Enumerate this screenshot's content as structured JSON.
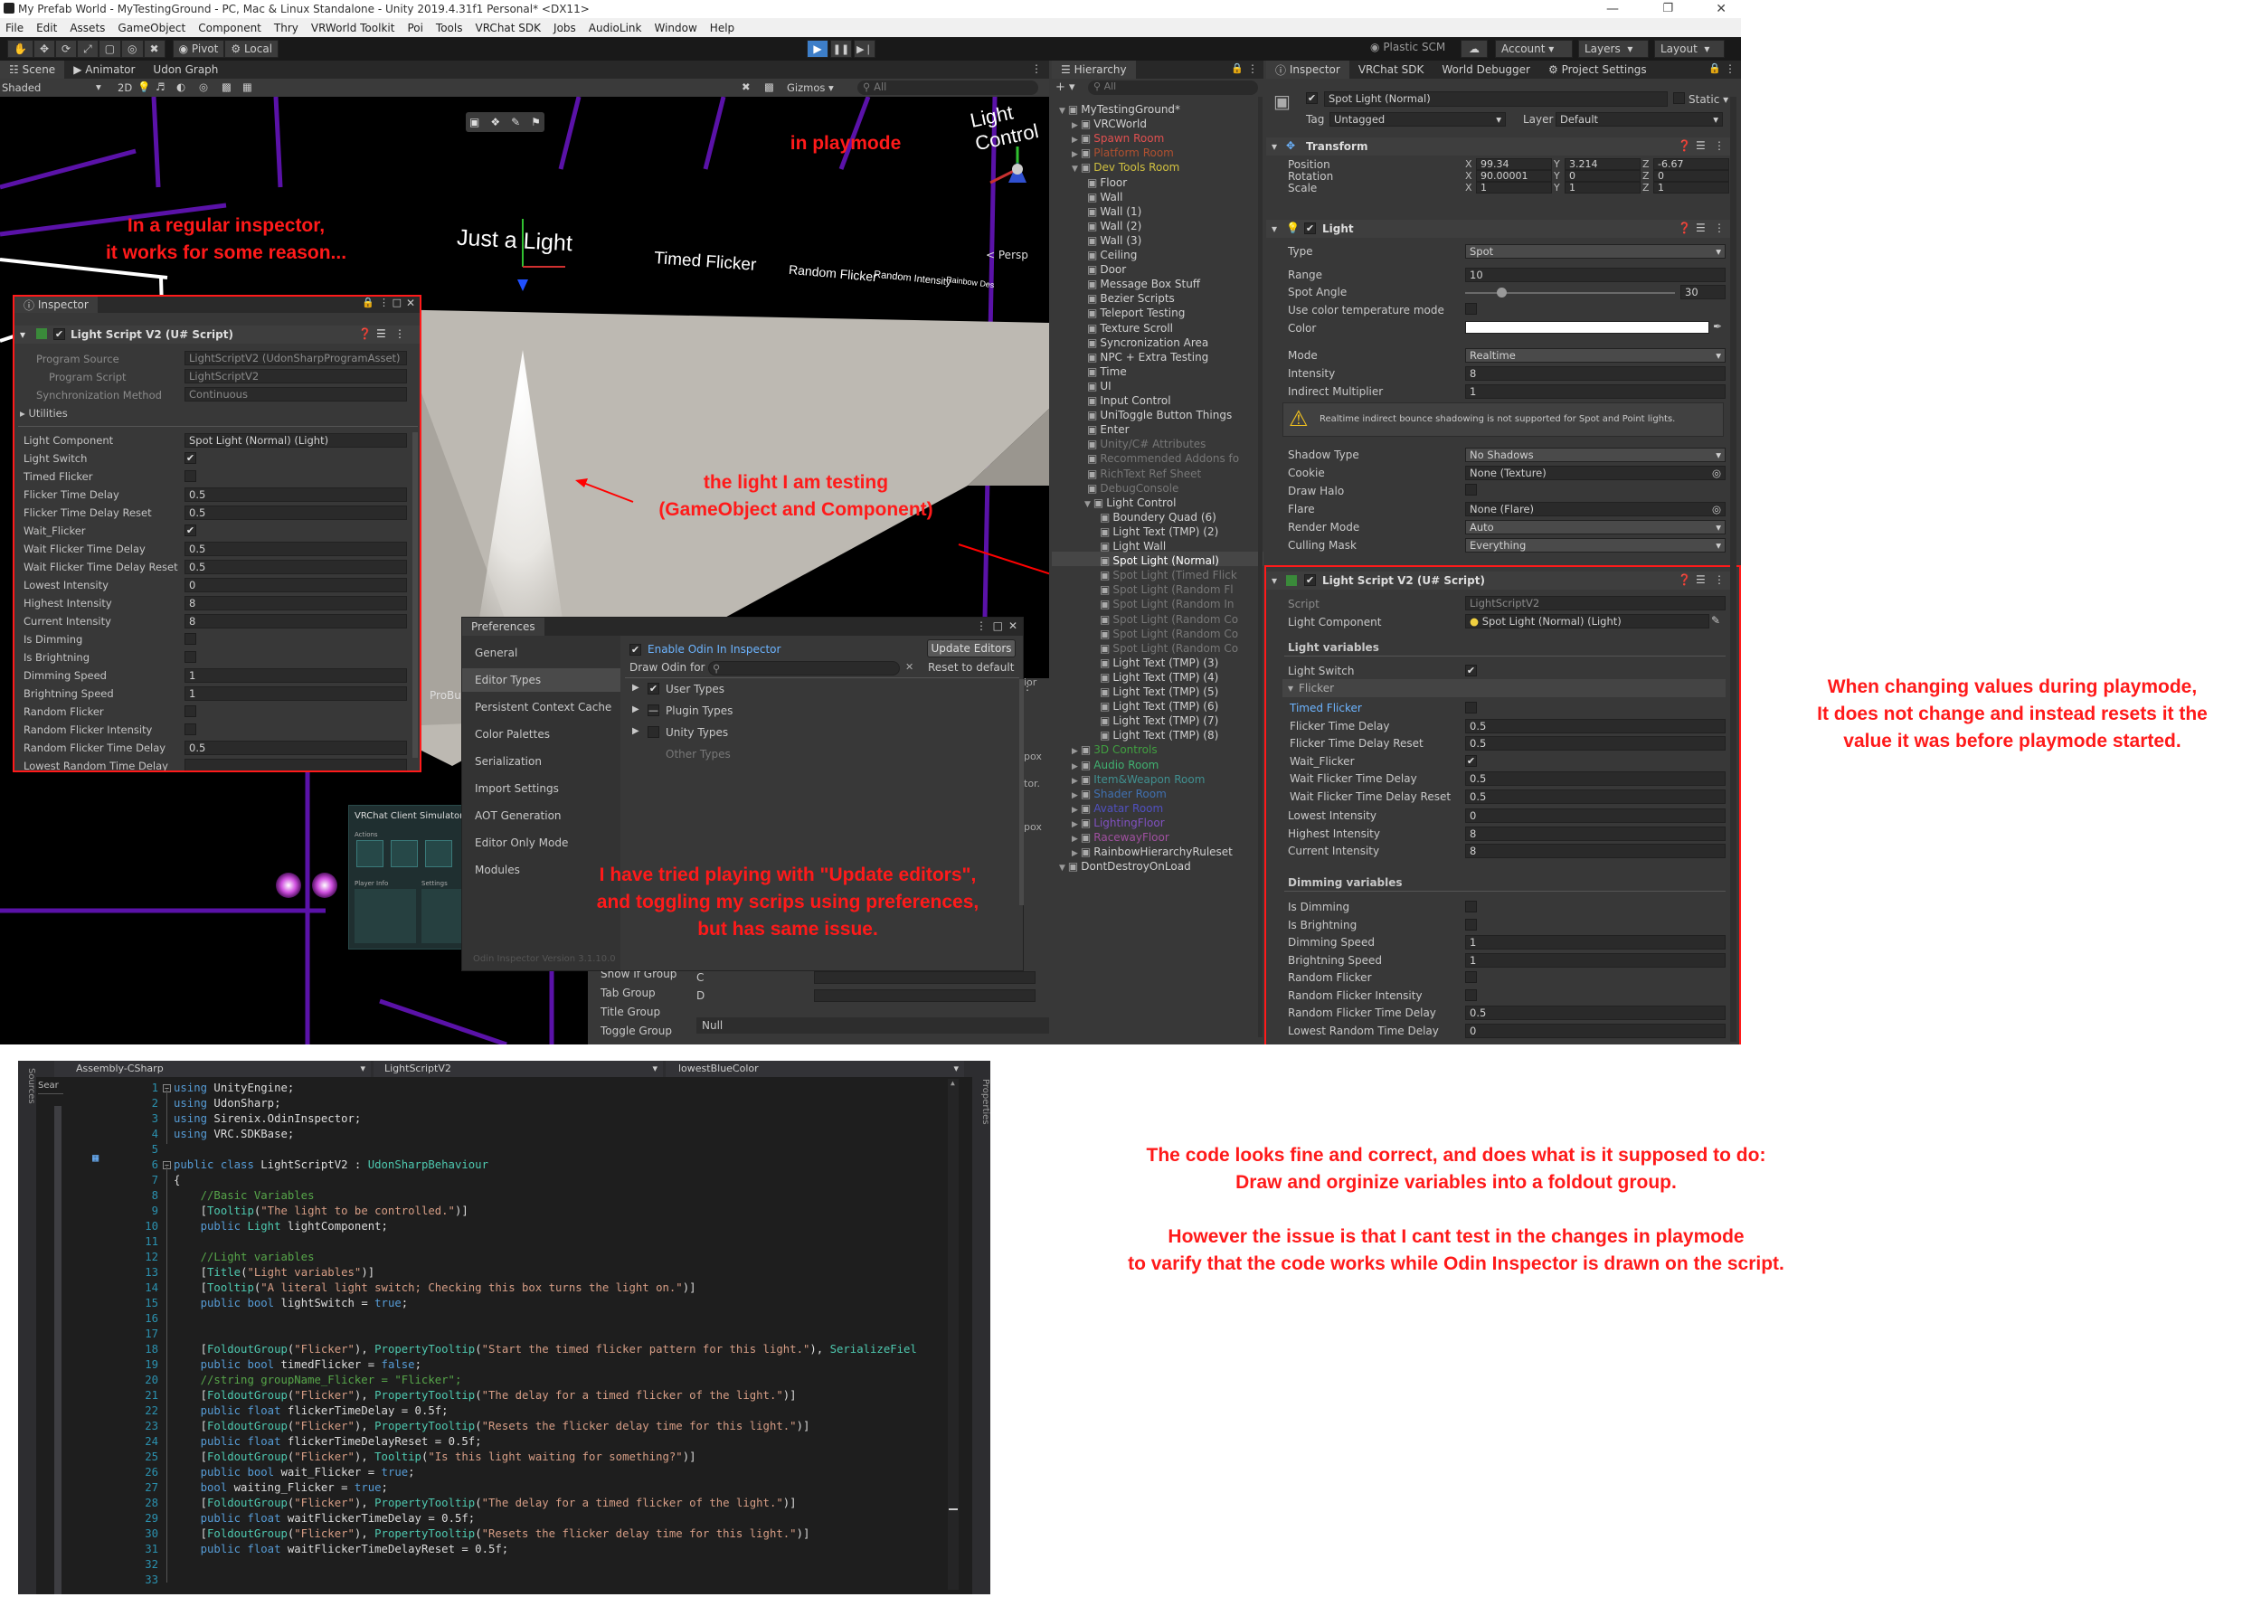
{
  "window": {
    "title": "My Prefab World - MyTestingGround - PC, Mac & Linux Standalone - Unity 2019.4.31f1 Personal* <DX11>"
  },
  "menu": [
    "File",
    "Edit",
    "Assets",
    "GameObject",
    "Component",
    "Thry",
    "VRWorld Toolkit",
    "Poi",
    "Tools",
    "VRChat SDK",
    "Jobs",
    "AudioLink",
    "Window",
    "Help"
  ],
  "toolbar": {
    "pivot": "Pivot",
    "local": "Local",
    "plastic": "Plastic SCM",
    "account": "Account",
    "layers": "Layers",
    "layout": "Layout"
  },
  "scene": {
    "tabs": [
      "Scene",
      "Animator",
      "Udon Graph"
    ],
    "shading": "Shaded",
    "mode2d": "2D",
    "gizmos": "Gizmos",
    "search_placeholder": "All",
    "persp": "Persp",
    "labels": {
      "just_a_light": "Just a Light",
      "timed_flicker": "Timed Flicker",
      "random_flicker": "Random Flicker",
      "random_intensity": "Random Intensity",
      "rainbow": "Rainbow Des",
      "light_control": "Light Control",
      "probu": "ProBu"
    }
  },
  "annotations": {
    "playmode": "in playmode",
    "regular": "In a regular inspector,\nit works for some reason...",
    "light_testing": "the light I am testing\n(GameObject and Component)",
    "tried": "I have tried playing with \"Update editors\",\nand toggling my scrips using preferences,\nbut has same issue.",
    "changing": "When changing values during playmode,\nIt does not change and instead resets it the\nvalue it was before playmode started.",
    "code_fine": "The code looks fine and correct, and does what is it supposed to do:\nDraw and orginize variables into a foldout group.",
    "cant_test": "However the issue is that I cant test in the changes in playmode\nto varify that the code works while Odin Inspector is drawn on the script."
  },
  "float_inspector": {
    "tab": "Inspector",
    "component": "Light Script V2 (U# Script)",
    "program_source_label": "Program Source",
    "program_source_value": "LightScriptV2 (UdonSharpProgramAsset)",
    "program_script_label": "Program Script",
    "program_script_value": "LightScriptV2",
    "sync_label": "Synchronization Method",
    "sync_value": "Continuous",
    "utilities": "Utilities",
    "rows": [
      {
        "label": "Light Component",
        "value": "Spot Light (Normal) (Light)"
      },
      {
        "label": "Light Switch",
        "value": "✔"
      },
      {
        "label": "Timed Flicker",
        "value": ""
      },
      {
        "label": "Flicker Time Delay",
        "value": "0.5"
      },
      {
        "label": "Flicker Time Delay Reset",
        "value": "0.5"
      },
      {
        "label": "Wait_Flicker",
        "value": "✔"
      },
      {
        "label": "Wait Flicker Time Delay",
        "value": "0.5"
      },
      {
        "label": "Wait Flicker Time Delay Reset",
        "value": "0.5"
      },
      {
        "label": "Lowest Intensity",
        "value": "0"
      },
      {
        "label": "Highest Intensity",
        "value": "8"
      },
      {
        "label": "Current Intensity",
        "value": "8"
      },
      {
        "label": "Is Dimming",
        "value": ""
      },
      {
        "label": "Is Brightning",
        "value": ""
      },
      {
        "label": "Dimming Speed",
        "value": "1"
      },
      {
        "label": "Brightning Speed",
        "value": "1"
      },
      {
        "label": "Random Flicker",
        "value": ""
      },
      {
        "label": "Random Flicker Intensity",
        "value": ""
      },
      {
        "label": "Random Flicker Time Delay",
        "value": "0.5"
      },
      {
        "label": "Lowest Random Time Delay",
        "value": ""
      }
    ]
  },
  "preferences": {
    "title": "Preferences",
    "sidebar": [
      "General",
      "Editor Types",
      "Persistent Context Cache",
      "Color Palettes",
      "Serialization",
      "Import Settings",
      "AOT Generation",
      "Editor Only Mode",
      "Modules"
    ],
    "enable_odin": "Enable Odin In Inspector",
    "update_editors": "Update Editors",
    "draw_odin_for": "Draw Odin for",
    "reset_default": "Reset to default",
    "types": [
      "User Types",
      "Plugin Types",
      "Unity Types",
      "Other Types"
    ],
    "version": "Odin Inspector Version 3.1.10.0"
  },
  "behind_panel": {
    "items": [
      "Show If Group",
      "Tab Group",
      "Title Group",
      "Toggle Group"
    ],
    "c": "C",
    "d": "D",
    "null": "Null"
  },
  "simulator": {
    "title": "VRChat Client Simulator",
    "actions": "Actions",
    "player_info": "Player Info",
    "settings": "Settings"
  },
  "hierarchy": {
    "tab": "Hierarchy",
    "search": "All",
    "items": [
      {
        "t": "MyTestingGround*",
        "d": 0,
        "c": "#d0d0d0"
      },
      {
        "t": "VRCWorld",
        "d": 1,
        "c": "#d0d0d0"
      },
      {
        "t": "Spawn Room",
        "d": 1,
        "c": "#e05050"
      },
      {
        "t": "Platform Room",
        "d": 1,
        "c": "#b05030"
      },
      {
        "t": "Dev Tools Room",
        "d": 1,
        "c": "#d0c040"
      },
      {
        "t": "Floor",
        "d": 2,
        "c": "#d0d0d0"
      },
      {
        "t": "Wall",
        "d": 2,
        "c": "#d0d0d0"
      },
      {
        "t": "Wall (1)",
        "d": 2,
        "c": "#d0d0d0"
      },
      {
        "t": "Wall (2)",
        "d": 2,
        "c": "#d0d0d0"
      },
      {
        "t": "Wall (3)",
        "d": 2,
        "c": "#d0d0d0"
      },
      {
        "t": "Ceiling",
        "d": 2,
        "c": "#d0d0d0"
      },
      {
        "t": "Door",
        "d": 2,
        "c": "#d0d0d0"
      },
      {
        "t": "Message Box Stuff",
        "d": 2,
        "c": "#d0d0d0"
      },
      {
        "t": "Bezier Scripts",
        "d": 2,
        "c": "#d0d0d0"
      },
      {
        "t": "Teleport Testing",
        "d": 2,
        "c": "#d0d0d0"
      },
      {
        "t": "Texture Scroll",
        "d": 2,
        "c": "#d0d0d0"
      },
      {
        "t": "Syncronization Area",
        "d": 2,
        "c": "#d0d0d0"
      },
      {
        "t": "NPC + Extra Testing",
        "d": 2,
        "c": "#d0d0d0"
      },
      {
        "t": "Time",
        "d": 2,
        "c": "#d0d0d0"
      },
      {
        "t": "UI",
        "d": 2,
        "c": "#d0d0d0"
      },
      {
        "t": "Input Control",
        "d": 2,
        "c": "#d0d0d0"
      },
      {
        "t": "UniToggle Button Things",
        "d": 2,
        "c": "#d0d0d0"
      },
      {
        "t": "Enter",
        "d": 2,
        "c": "#d0d0d0"
      },
      {
        "t": "Unity/C# Attributes",
        "d": 2,
        "c": "#777777"
      },
      {
        "t": "Recommended Addons fo",
        "d": 2,
        "c": "#777777"
      },
      {
        "t": "RichText Ref Sheet",
        "d": 2,
        "c": "#777777"
      },
      {
        "t": "DebugConsole",
        "d": 2,
        "c": "#777777"
      },
      {
        "t": "Light Control",
        "d": 2,
        "c": "#d0d0d0"
      },
      {
        "t": "Boundery Quad (6)",
        "d": 3,
        "c": "#d0d0d0"
      },
      {
        "t": "Light Text (TMP) (2)",
        "d": 3,
        "c": "#d0d0d0"
      },
      {
        "t": "Light Wall",
        "d": 3,
        "c": "#d0d0d0"
      },
      {
        "t": "Spot Light (Normal)",
        "d": 3,
        "c": "#ffffff"
      },
      {
        "t": "Spot Light (Timed Flick",
        "d": 3,
        "c": "#777777"
      },
      {
        "t": "Spot Light (Random Fl",
        "d": 3,
        "c": "#777777"
      },
      {
        "t": "Spot Light (Random In",
        "d": 3,
        "c": "#777777"
      },
      {
        "t": "Spot Light (Random Co",
        "d": 3,
        "c": "#777777"
      },
      {
        "t": "Spot Light (Random Co",
        "d": 3,
        "c": "#777777"
      },
      {
        "t": "Spot Light (Random Co",
        "d": 3,
        "c": "#777777"
      },
      {
        "t": "Light Text (TMP) (3)",
        "d": 3,
        "c": "#d0d0d0"
      },
      {
        "t": "Light Text (TMP) (4)",
        "d": 3,
        "c": "#d0d0d0"
      },
      {
        "t": "Light Text (TMP) (5)",
        "d": 3,
        "c": "#d0d0d0"
      },
      {
        "t": "Light Text (TMP) (6)",
        "d": 3,
        "c": "#d0d0d0"
      },
      {
        "t": "Light Text (TMP) (7)",
        "d": 3,
        "c": "#d0d0d0"
      },
      {
        "t": "Light Text (TMP) (8)",
        "d": 3,
        "c": "#d0d0d0"
      },
      {
        "t": "3D Controls",
        "d": 1,
        "c": "#40a040"
      },
      {
        "t": "Audio Room",
        "d": 1,
        "c": "#40b070"
      },
      {
        "t": "Item&Weapon Room",
        "d": 1,
        "c": "#409090"
      },
      {
        "t": "Shader Room",
        "d": 1,
        "c": "#4070b0"
      },
      {
        "t": "Avatar Room",
        "d": 1,
        "c": "#5050c0"
      },
      {
        "t": "LightingFloor",
        "d": 1,
        "c": "#8050c0"
      },
      {
        "t": "RacewayFloor",
        "d": 1,
        "c": "#a050a0"
      },
      {
        "t": "RainbowHierarchyRuleset",
        "d": 1,
        "c": "#d0d0d0"
      },
      {
        "t": "DontDestroyOnLoad",
        "d": 0,
        "c": "#d0d0d0"
      }
    ]
  },
  "inspector": {
    "tabs": [
      "Inspector",
      "VRChat SDK",
      "World Debugger",
      "Project Settings"
    ],
    "object_name": "Spot Light (Normal)",
    "static": "Static",
    "tag_label": "Tag",
    "tag_value": "Untagged",
    "layer_label": "Layer",
    "layer_value": "Default",
    "transform": {
      "title": "Transform",
      "position": {
        "label": "Position",
        "x": "99.34",
        "y": "3.214",
        "z": "-6.67"
      },
      "rotation": {
        "label": "Rotation",
        "x": "90.00001",
        "y": "0",
        "z": "0"
      },
      "scale": {
        "label": "Scale",
        "x": "1",
        "y": "1",
        "z": "1"
      }
    },
    "light": {
      "title": "Light",
      "type": {
        "label": "Type",
        "value": "Spot"
      },
      "range": {
        "label": "Range",
        "value": "10"
      },
      "spot_angle": {
        "label": "Spot Angle",
        "value": "30"
      },
      "use_temp": "Use color temperature mode",
      "color": "Color",
      "mode": {
        "label": "Mode",
        "value": "Realtime"
      },
      "intensity": {
        "label": "Intensity",
        "value": "8"
      },
      "indirect": {
        "label": "Indirect Multiplier",
        "value": "1"
      },
      "warning": "Realtime indirect bounce shadowing is not supported for Spot and Point lights.",
      "shadow": {
        "label": "Shadow Type",
        "value": "No Shadows"
      },
      "cookie": {
        "label": "Cookie",
        "value": "None (Texture)"
      },
      "halo": "Draw Halo",
      "flare": {
        "label": "Flare",
        "value": "None (Flare)"
      },
      "render_mode": {
        "label": "Render Mode",
        "value": "Auto"
      },
      "culling": {
        "label": "Culling Mask",
        "value": "Everything"
      }
    },
    "script": {
      "title": "Light Script V2 (U# Script)",
      "script_label": "Script",
      "script_value": "LightScriptV2",
      "light_comp_label": "Light Component",
      "light_comp_value": "Spot Light (Normal) (Light)",
      "light_vars": "Light variables",
      "light_switch": "Light Switch",
      "flicker": "Flicker",
      "flicker_rows": [
        {
          "label": "Timed Flicker",
          "value": ""
        },
        {
          "label": "Flicker Time Delay",
          "value": "0.5"
        },
        {
          "label": "Flicker Time Delay Reset",
          "value": "0.5"
        },
        {
          "label": "Wait_Flicker",
          "value": "✔"
        },
        {
          "label": "Wait Flicker Time Delay",
          "value": "0.5"
        },
        {
          "label": "Wait Flicker Time Delay Reset",
          "value": "0.5"
        }
      ],
      "intensity_rows": [
        {
          "label": "Lowest Intensity",
          "value": "0"
        },
        {
          "label": "Highest Intensity",
          "value": "8"
        },
        {
          "label": "Current Intensity",
          "value": "8"
        }
      ],
      "dimming_vars": "Dimming variables",
      "dimming_rows": [
        {
          "label": "Is Dimming",
          "value": ""
        },
        {
          "label": "Is Brightning",
          "value": ""
        },
        {
          "label": "Dimming Speed",
          "value": "1"
        },
        {
          "label": "Brightning Speed",
          "value": "1"
        },
        {
          "label": "Random Flicker",
          "value": ""
        },
        {
          "label": "Random Flicker Intensity",
          "value": ""
        },
        {
          "label": "Random Flicker Time Delay",
          "value": "0.5"
        },
        {
          "label": "Lowest Random Time Delay",
          "value": "0"
        }
      ]
    }
  },
  "code": {
    "project": "Assembly-CSharp",
    "class_dd": "LightScriptV2",
    "member_dd": "lowestBlueColor",
    "side_left": "Sources",
    "side_search": "Sear",
    "side_right": "Properties",
    "lines": [
      "using UnityEngine;",
      "using UdonSharp;",
      "using Sirenix.OdinInspector;",
      "using VRC.SDKBase;",
      "",
      "public class LightScriptV2 : UdonSharpBehaviour",
      "{",
      "    //Basic Variables",
      "    [Tooltip(\"The light to be controlled.\")]",
      "    public Light lightComponent;",
      "",
      "    //Light variables",
      "    [Title(\"Light variables\")]",
      "    [Tooltip(\"A literal light switch; Checking this box turns the light on.\")]",
      "    public bool lightSwitch = true;",
      "",
      "",
      "    [FoldoutGroup(\"Flicker\"), PropertyTooltip(\"Start the timed flicker pattern for this light.\"), SerializeFiel",
      "    public bool timedFlicker = false;",
      "    //string groupName_Flicker = \"Flicker\";",
      "    [FoldoutGroup(\"Flicker\"), PropertyTooltip(\"The delay for a timed flicker of the light.\")]",
      "    public float flickerTimeDelay = 0.5f;",
      "    [FoldoutGroup(\"Flicker\"), PropertyTooltip(\"Resets the flicker delay time for this light.\")]",
      "    public float flickerTimeDelayReset = 0.5f;",
      "    [FoldoutGroup(\"Flicker\"), Tooltip(\"Is this light waiting for something?\")]",
      "    public bool wait_Flicker = true;",
      "    bool waiting_Flicker = true;",
      "    [FoldoutGroup(\"Flicker\"), PropertyTooltip(\"The delay for a timed flicker of the light.\")]",
      "    public float waitFlickerTimeDelay = 0.5f;",
      "    [FoldoutGroup(\"Flicker\"), PropertyTooltip(\"Resets the flicker delay time for this light.\")]",
      "    public float waitFlickerTimeDelayReset = 0.5f;",
      "",
      ""
    ]
  }
}
